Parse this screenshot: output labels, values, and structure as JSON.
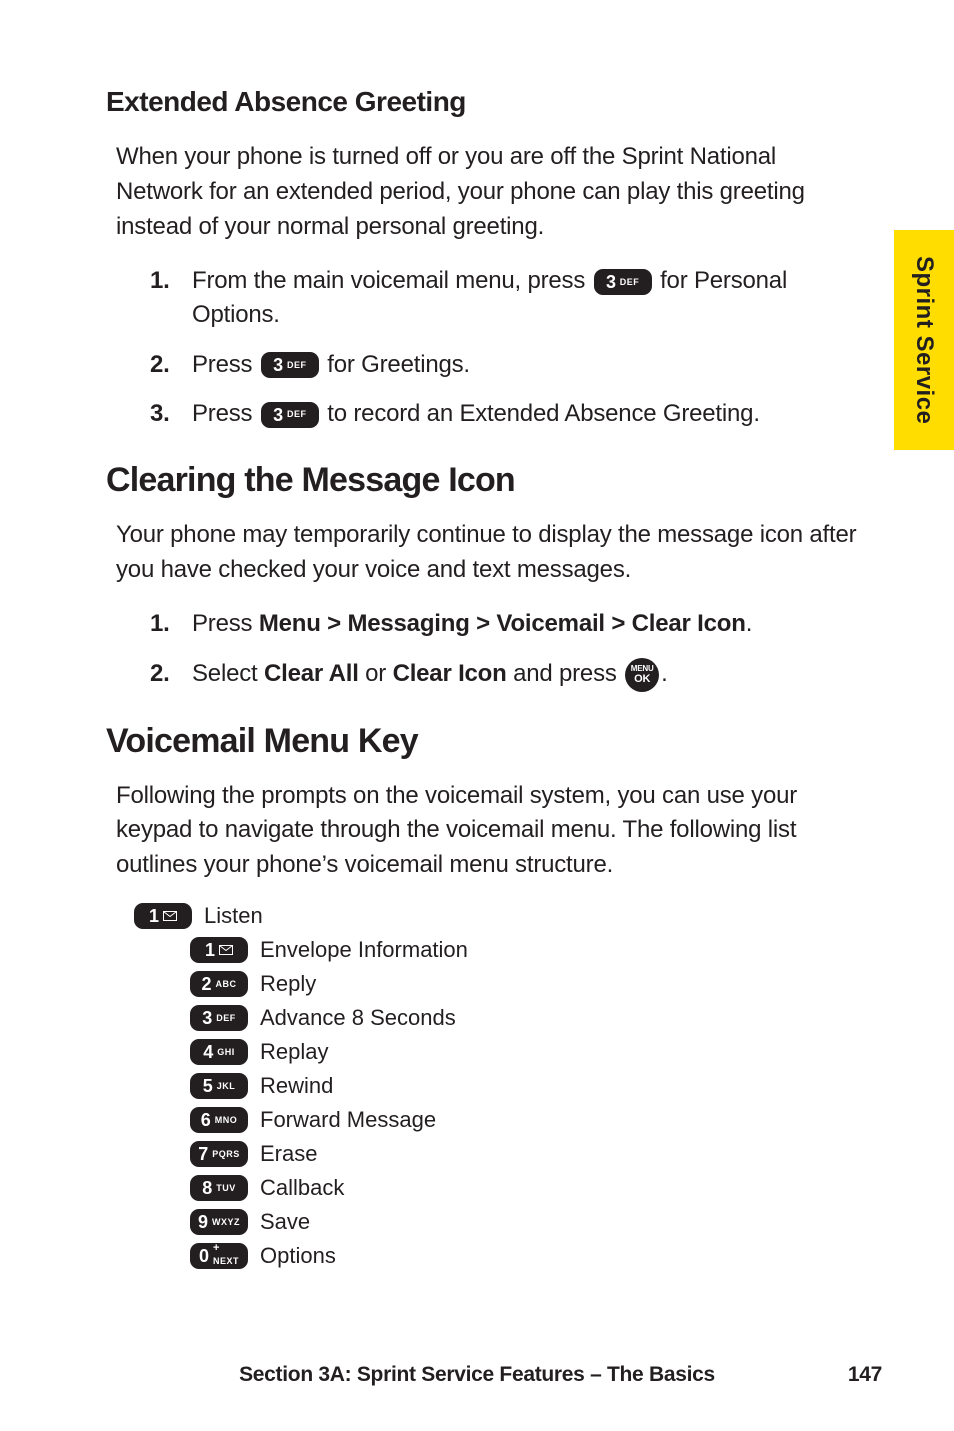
{
  "sideTab": "Sprint Service",
  "h_extended": "Extended Absence Greeting",
  "p_extended": "When your phone is turned off or you are off the Sprint National Network for an extended period, your phone can play this greeting instead of your normal personal greeting.",
  "steps_ext": {
    "n1": "1.",
    "s1a": "From the main voicemail menu, press ",
    "s1b": " for Personal Options.",
    "n2": "2.",
    "s2a": "Press ",
    "s2b": " for Greetings.",
    "n3": "3.",
    "s3a": "Press ",
    "s3b": " to record an Extended Absence Greeting."
  },
  "h_clearing": "Clearing the Message Icon",
  "p_clearing": "Your phone may temporarily continue to display the message icon after you have checked your voice and text messages.",
  "steps_clr": {
    "n1": "1.",
    "s1a": "Press ",
    "s1b": "Menu > Messaging > Voicemail > Clear Icon",
    "s1c": ".",
    "n2": "2.",
    "s2a": "Select ",
    "s2b": "Clear All",
    "s2c": " or ",
    "s2d": "Clear Icon",
    "s2e": " and press ",
    "s2f": "."
  },
  "h_vmkey": "Voicemail Menu Key",
  "p_vmkey": "Following the prompts on the voicemail system, you can use your keypad to navigate through the voicemail menu. The following list outlines your phone’s voicemail menu structure.",
  "keys": {
    "k1": {
      "big": "1",
      "small": ""
    },
    "k2": {
      "big": "2",
      "small": "ABC"
    },
    "k3": {
      "big": "3",
      "small": "DEF"
    },
    "k4": {
      "big": "4",
      "small": "GHI"
    },
    "k5": {
      "big": "5",
      "small": "JKL"
    },
    "k6": {
      "big": "6",
      "small": "MNO"
    },
    "k7": {
      "big": "7",
      "small": "PQRS"
    },
    "k8": {
      "big": "8",
      "small": "TUV"
    },
    "k9": {
      "big": "9",
      "small": "WXYZ"
    },
    "k0": {
      "big": "0",
      "small": "NEXT"
    },
    "ok": {
      "t1": "MENU",
      "t2": "OK"
    }
  },
  "menu": {
    "listen": "Listen",
    "items": {
      "i1": "Envelope Information",
      "i2": "Reply",
      "i3": "Advance 8 Seconds",
      "i4": "Replay",
      "i5": "Rewind",
      "i6": "Forward Message",
      "i7": "Erase",
      "i8": "Callback",
      "i9": "Save",
      "i0": "Options"
    }
  },
  "footer": {
    "text": "Section 3A: Sprint Service Features – The Basics",
    "page": "147"
  }
}
